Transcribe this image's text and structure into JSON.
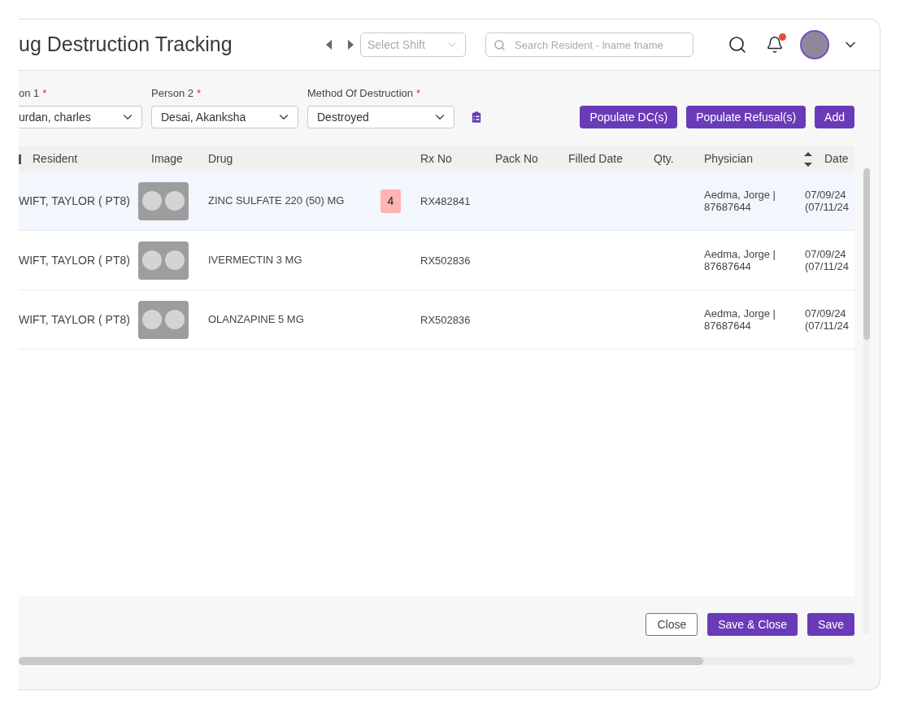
{
  "header": {
    "title": "ug Destruction Tracking",
    "shift_select": {
      "placeholder": "Select Shift"
    },
    "search": {
      "placeholder": "Search Resident - lname fname"
    },
    "notifications": {
      "unread": true
    }
  },
  "filters": [
    {
      "label": "on 1",
      "required_mark": "*",
      "value": "urdan, charles"
    },
    {
      "label": "Person 2",
      "required_mark": "*",
      "value": "Desai, Akanksha"
    },
    {
      "label": "Method Of Destruction",
      "required_mark": "*",
      "value": "Destroyed"
    }
  ],
  "actions": [
    "Populate DC(s)",
    "Populate Refusal(s)",
    "Add"
  ],
  "table": {
    "columns": [
      "Resident",
      "Image",
      "Drug",
      "Rx No",
      "Pack No",
      "Filled Date",
      "Qty.",
      "Physician",
      "Date"
    ],
    "rows": [
      {
        "selected": true,
        "resident": "WIFT, TAYLOR ( PT8)",
        "drug": "ZINC SULFATE 220 (50) MG",
        "badge": "4",
        "rx_no": "RX482841",
        "physician": [
          "Aedma, Jorge |",
          "87687644"
        ],
        "date": [
          "07/09/24",
          "(07/11/24"
        ]
      },
      {
        "selected": false,
        "resident": "WIFT, TAYLOR ( PT8)",
        "drug": "IVERMECTIN 3 MG",
        "rx_no": "RX502836",
        "physician": [
          "Aedma, Jorge |",
          "87687644"
        ],
        "date": [
          "07/09/24",
          "(07/11/24"
        ]
      },
      {
        "selected": false,
        "resident": "WIFT, TAYLOR ( PT8)",
        "drug": "OLANZAPINE 5 MG",
        "rx_no": "RX502836",
        "physician": [
          "Aedma, Jorge |",
          "87687644"
        ],
        "date": [
          "07/09/24",
          "(07/11/24"
        ]
      }
    ]
  },
  "footer_buttons": [
    {
      "label": "Close",
      "kind": "outline"
    },
    {
      "label": "Save & Close",
      "kind": "primary"
    },
    {
      "label": "Save",
      "kind": "primary"
    }
  ]
}
